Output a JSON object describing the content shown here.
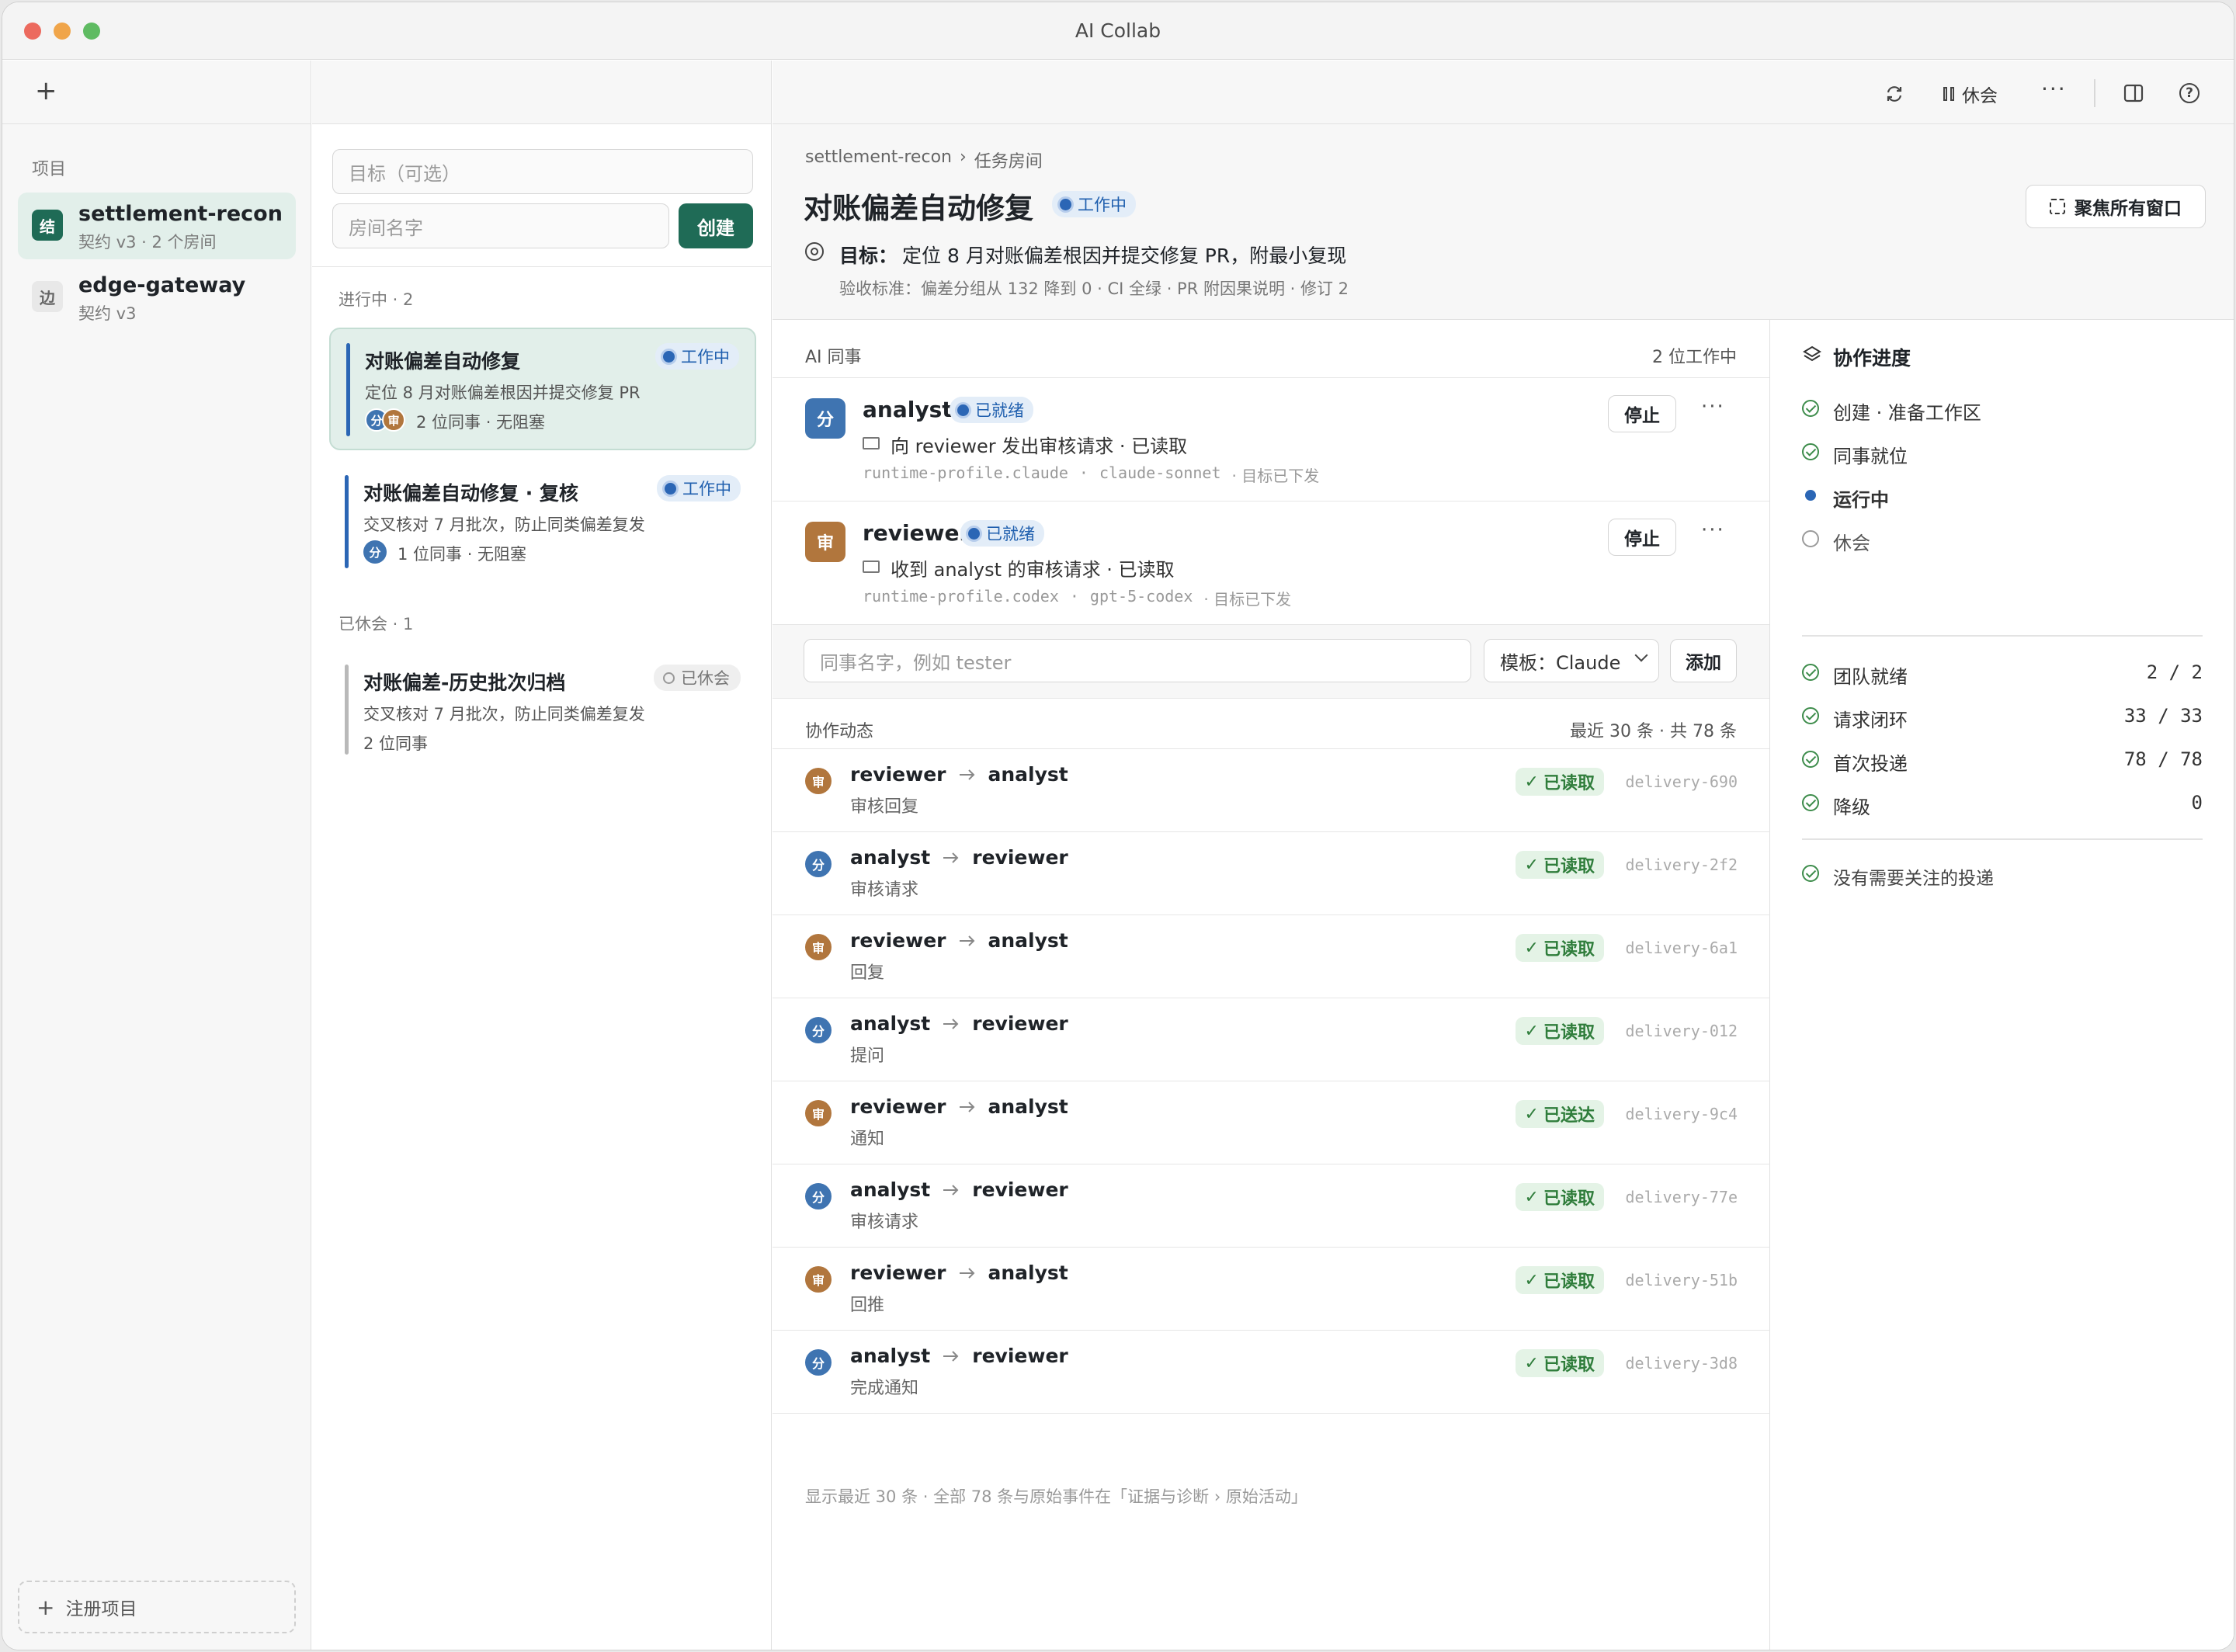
{
  "app": {
    "title": "AI Collab"
  },
  "sidebar": {
    "section_label": "项目",
    "projects": [
      {
        "avatar": "结",
        "name": "settlement-recon",
        "meta": "契约 v3 · 2 个房间"
      },
      {
        "avatar": "边",
        "name": "edge-gateway",
        "meta": "契约 v3"
      }
    ],
    "register_label": "注册项目"
  },
  "rooms": {
    "goal_placeholder": "目标（可选）",
    "name_placeholder": "房间名字",
    "create_label": "创建",
    "active_header": "进行中 · 2",
    "paused_header": "已休会 · 1",
    "items": [
      {
        "title": "对账偏差自动修复",
        "status": "工作中",
        "desc": "定位 8 月对账偏差根因并提交修复 PR",
        "meta": "2 位同事 · 无阻塞",
        "avatars": [
          "分",
          "审"
        ]
      },
      {
        "title": "对账偏差自动修复 · 复核",
        "status": "工作中",
        "desc": "交叉核对 7 月批次，防止同类偏差复发",
        "meta": "1 位同事 · 无阻塞",
        "avatars": [
          "分"
        ]
      },
      {
        "title": "对账偏差-历史批次归档",
        "status": "已休会",
        "desc": "交叉核对 7 月批次，防止同类偏差复发",
        "meta": "2 位同事",
        "avatars": []
      }
    ]
  },
  "toolbar": {
    "pause_label": "休会"
  },
  "room": {
    "breadcrumb_project": "settlement-recon",
    "breadcrumb_sep": "›",
    "breadcrumb_page": "任务房间",
    "title": "对账偏差自动修复",
    "status": "工作中",
    "focus_label": "聚焦所有窗口",
    "goal_label": "目标：",
    "goal_text": "定位 8 月对账偏差根因并提交修复 PR，附最小复现",
    "criteria": "验收标准：偏差分组从 132 降到 0 · CI 全绿 · PR 附因果说明 · 修订 2"
  },
  "colleagues": {
    "header": "AI 同事",
    "count": "2 位工作中",
    "stop_label": "停止",
    "items": [
      {
        "avatar": "分",
        "name": "analyst",
        "status": "已就绪",
        "message": "向 reviewer 发出审核请求 · 已读取",
        "profile": "runtime-profile.claude",
        "sep": "·",
        "model": "claude-sonnet",
        "note": "· 目标已下发"
      },
      {
        "avatar": "审",
        "name": "reviewer",
        "status": "已就绪",
        "message": "收到 analyst 的审核请求 · 已读取",
        "profile": "runtime-profile.codex",
        "sep": "·",
        "model": "gpt-5-codex",
        "note": "· 目标已下发"
      }
    ],
    "add_placeholder": "同事名字，例如 tester",
    "template_label": "模板：Claude",
    "add_label": "添加"
  },
  "activity": {
    "header": "协作动态",
    "count": "最近 30 条 · 共 78 条",
    "items": [
      {
        "avatar": "审",
        "from": "reviewer",
        "to": "analyst",
        "kind": "审核回复",
        "status": "已读取",
        "id": "delivery-690"
      },
      {
        "avatar": "分",
        "from": "analyst",
        "to": "reviewer",
        "kind": "审核请求",
        "status": "已读取",
        "id": "delivery-2f2"
      },
      {
        "avatar": "审",
        "from": "reviewer",
        "to": "analyst",
        "kind": "回复",
        "status": "已读取",
        "id": "delivery-6a1"
      },
      {
        "avatar": "分",
        "from": "analyst",
        "to": "reviewer",
        "kind": "提问",
        "status": "已读取",
        "id": "delivery-012"
      },
      {
        "avatar": "审",
        "from": "reviewer",
        "to": "analyst",
        "kind": "通知",
        "status": "已送达",
        "id": "delivery-9c4"
      },
      {
        "avatar": "分",
        "from": "analyst",
        "to": "reviewer",
        "kind": "审核请求",
        "status": "已读取",
        "id": "delivery-77e"
      },
      {
        "avatar": "审",
        "from": "reviewer",
        "to": "analyst",
        "kind": "回推",
        "status": "已读取",
        "id": "delivery-51b"
      },
      {
        "avatar": "分",
        "from": "analyst",
        "to": "reviewer",
        "kind": "完成通知",
        "status": "已读取",
        "id": "delivery-3d8"
      }
    ],
    "footer": "显示最近 30 条 · 全部 78 条与原始事件在「证据与诊断 › 原始活动」"
  },
  "progress": {
    "header": "协作进度",
    "steps": [
      {
        "label": "创建 · 准备工作区",
        "state": "done"
      },
      {
        "label": "同事就位",
        "state": "done"
      },
      {
        "label": "运行中",
        "state": "current"
      },
      {
        "label": "休会",
        "state": "pending"
      }
    ],
    "metrics": [
      {
        "label": "团队就绪",
        "value": "2 / 2"
      },
      {
        "label": "请求闭环",
        "value": "33 / 33"
      },
      {
        "label": "首次投递",
        "value": "78 / 78"
      },
      {
        "label": "降级",
        "value": "0"
      }
    ],
    "note": "没有需要关注的投递"
  },
  "colors": {
    "accent": "#1f6b56",
    "blue": "#3f74b1",
    "brown": "#b1763d",
    "green": "#3d8c4b"
  }
}
